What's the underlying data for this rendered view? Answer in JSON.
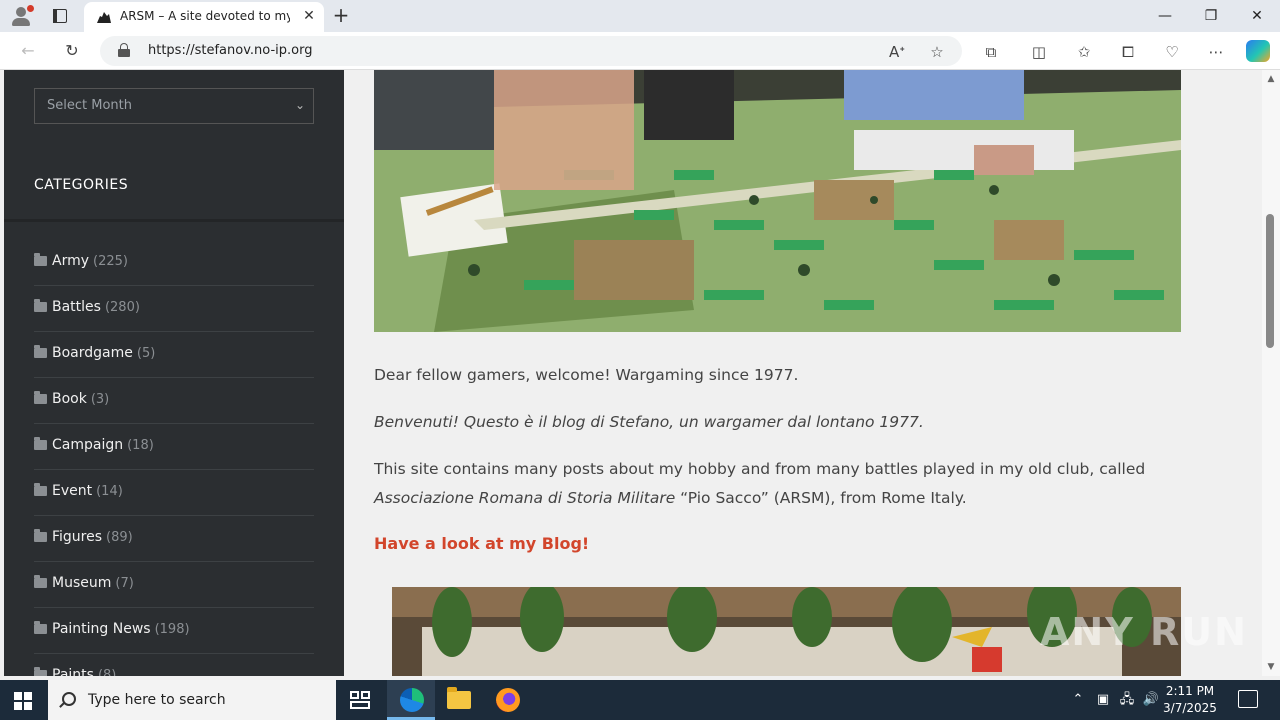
{
  "browser": {
    "tab_title": "ARSM – A site devoted to my Wa",
    "url": "https://stefanov.no-ip.org",
    "new_tab_symbol": "+",
    "close_tab_symbol": "✕"
  },
  "sidebar": {
    "archive_select": {
      "selected": "Select Month"
    },
    "categories_heading": "CATEGORIES",
    "categories": [
      {
        "name": "Army",
        "count": "(225)"
      },
      {
        "name": "Battles",
        "count": "(280)"
      },
      {
        "name": "Boardgame",
        "count": "(5)"
      },
      {
        "name": "Book",
        "count": "(3)"
      },
      {
        "name": "Campaign",
        "count": "(18)"
      },
      {
        "name": "Event",
        "count": "(14)"
      },
      {
        "name": "Figures",
        "count": "(89)"
      },
      {
        "name": "Museum",
        "count": "(7)"
      },
      {
        "name": "Painting News",
        "count": "(198)"
      },
      {
        "name": "Paints",
        "count": "(8)"
      }
    ]
  },
  "content": {
    "welcome": "Dear fellow gamers, welcome! Wargaming since 1977.",
    "welcome_it": "Benvenuti! Questo è il blog di Stefano, un wargamer dal lontano 1977.",
    "about_1": "This site contains many posts about my hobby and from many battles played in my old club, called",
    "about_club_italic": "Associazione Romana di Storia Militare",
    "about_2": " “Pio Sacco” (ARSM), from Rome Italy.",
    "blog_link": "Have a look at my Blog!"
  },
  "watermark": "ANY RUN",
  "taskbar": {
    "search_placeholder": "Type here to search",
    "time": "2:11 PM",
    "date": "3/7/2025"
  },
  "colors": {
    "sidebar_bg": "#2b2e31",
    "link_accent": "#d2452b",
    "taskbar_bg": "#1c2b3a"
  }
}
